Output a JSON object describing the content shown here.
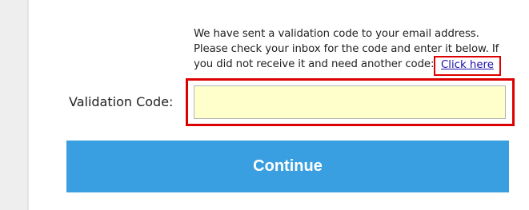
{
  "message": {
    "line1": "We have sent a validation code to your email address.",
    "line2": "Please check your inbox for the code and enter it below. If",
    "line3": "you did not receive it and need another code:",
    "link_label": "Click here"
  },
  "form": {
    "code_label": "Validation Code:",
    "code_value": "",
    "code_placeholder": ""
  },
  "actions": {
    "continue_label": "Continue"
  },
  "colors": {
    "button": "#3a9fe0",
    "input_background": "#ffffcc",
    "highlight_border": "#dd0000",
    "link": "#1a0dab",
    "side_strip": "#eeeeee"
  }
}
